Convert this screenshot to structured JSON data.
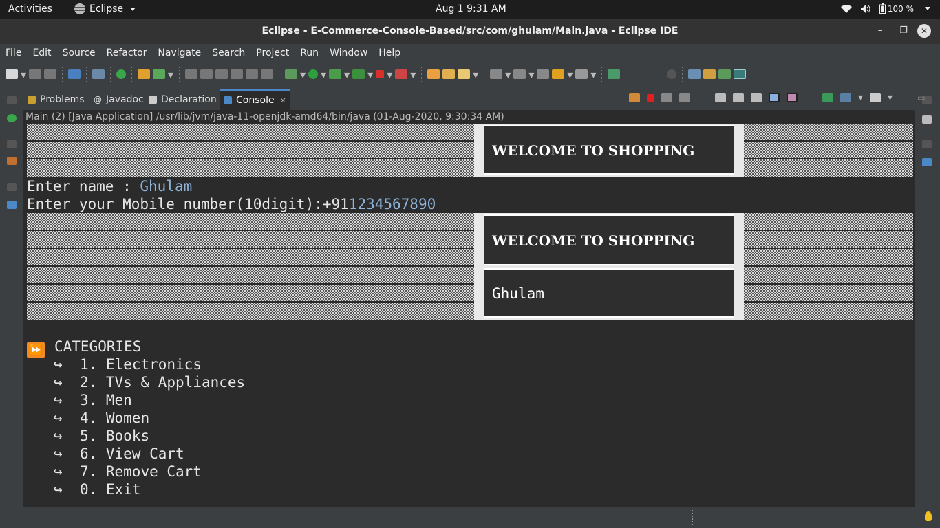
{
  "system": {
    "activities": "Activities",
    "app_name": "Eclipse",
    "clock": "Aug 1  9:31 AM",
    "battery": "100 %"
  },
  "window": {
    "title": "Eclipse - E-Commerce-Console-Based/src/com/ghulam/Main.java - Eclipse IDE"
  },
  "menu": [
    "File",
    "Edit",
    "Source",
    "Refactor",
    "Navigate",
    "Search",
    "Project",
    "Run",
    "Window",
    "Help"
  ],
  "view_tabs": {
    "problems": "Problems",
    "javadoc": "Javadoc",
    "declaration": "Declaration",
    "console": "Console"
  },
  "console": {
    "description": "Main (2) [Java Application] /usr/lib/jvm/java-11-openjdk-amd64/bin/java  (01-Aug-2020, 9:30:34 AM)",
    "banner_title": "WELCOME TO SHOPPING",
    "prompt_name": "Enter name : ",
    "input_name": "Ghulam",
    "prompt_mobile": "Enter your Mobile number(10digit):+91",
    "input_mobile": "1234567890",
    "banner_name": "Ghulam",
    "categories_heading": "CATEGORIES",
    "arrow": "↪",
    "categories": [
      "1. Electronics",
      "2. TVs & Appliances",
      "3. Men",
      "4. Women",
      "5. Books",
      "6. View Cart",
      "7. Remove Cart",
      "0. Exit"
    ]
  },
  "colors": {
    "accent": "#4a88c7",
    "user_input": "#8fb3d9",
    "background": "#2b2b2b"
  }
}
